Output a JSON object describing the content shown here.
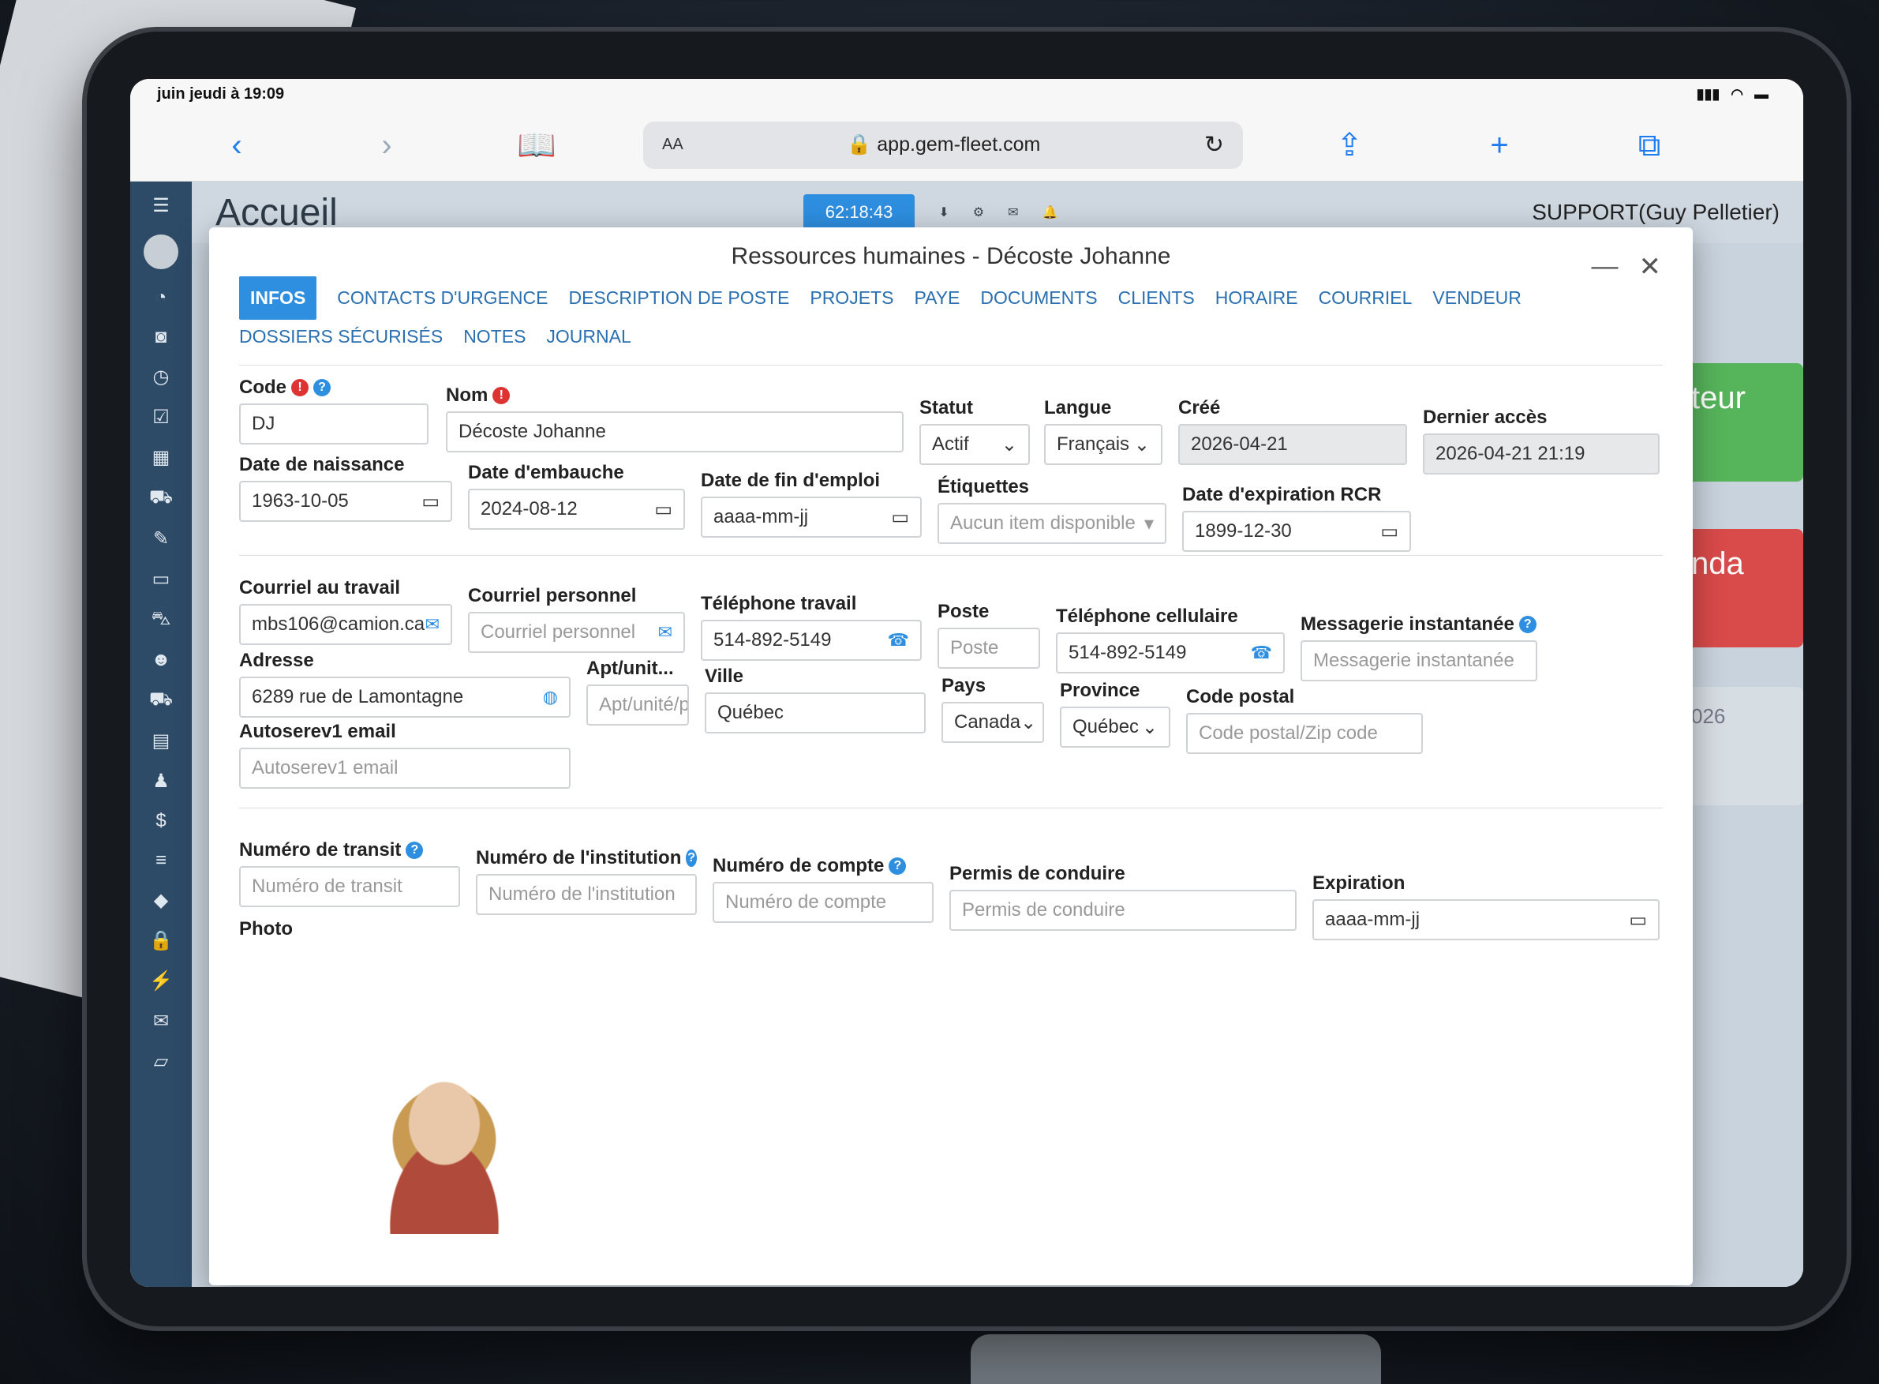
{
  "status": {
    "time": "juin jeudi à 19:09"
  },
  "browser": {
    "text_size": "AA",
    "url": "app.gem-fleet.com"
  },
  "app": {
    "title": "Accueil",
    "timer": "62:18:43",
    "user": "SUPPORT(Guy Pelletier)",
    "side_cards": [
      "teur",
      "nda",
      "026"
    ]
  },
  "modal": {
    "title": "Ressources humaines - Décoste Johanne",
    "tabs": [
      "INFOS",
      "CONTACTS D'URGENCE",
      "DESCRIPTION DE POSTE",
      "PROJETS",
      "PAYE",
      "DOCUMENTS",
      "CLIENTS",
      "HORAIRE",
      "COURRIEL",
      "VENDEUR"
    ],
    "tabs_row2": [
      "DOSSIERS SÉCURISÉS",
      "NOTES",
      "JOURNAL"
    ]
  },
  "form": {
    "code": {
      "label": "Code",
      "value": "DJ"
    },
    "nom": {
      "label": "Nom",
      "value": "Décoste Johanne"
    },
    "statut": {
      "label": "Statut",
      "value": "Actif"
    },
    "langue": {
      "label": "Langue",
      "value": "Français"
    },
    "cree": {
      "label": "Créé",
      "value": "2026-04-21"
    },
    "dernier_acces": {
      "label": "Dernier accès",
      "value": "2026-04-21 21:19"
    },
    "date_naissance": {
      "label": "Date de naissance",
      "value": "1963-10-05"
    },
    "date_embauche": {
      "label": "Date d'embauche",
      "value": "2024-08-12"
    },
    "date_fin": {
      "label": "Date de fin d'emploi",
      "placeholder": "aaaa-mm-jj"
    },
    "etiquettes": {
      "label": "Étiquettes",
      "placeholder": "Aucun item disponible"
    },
    "date_rcr": {
      "label": "Date d'expiration RCR",
      "value": "1899-12-30"
    },
    "courriel_travail": {
      "label": "Courriel au travail",
      "value": "mbs106@camion.ca"
    },
    "courriel_perso": {
      "label": "Courriel personnel",
      "placeholder": "Courriel personnel"
    },
    "tel_travail": {
      "label": "Téléphone travail",
      "value": "514-892-5149"
    },
    "poste": {
      "label": "Poste",
      "placeholder": "Poste"
    },
    "tel_cell": {
      "label": "Téléphone cellulaire",
      "value": "514-892-5149"
    },
    "messagerie": {
      "label": "Messagerie instantanée",
      "placeholder": "Messagerie instantanée"
    },
    "adresse": {
      "label": "Adresse",
      "value": "6289 rue de Lamontagne"
    },
    "apt": {
      "label": "Apt/unit...",
      "placeholder": "Apt/unité/porte"
    },
    "ville": {
      "label": "Ville",
      "value": "Québec"
    },
    "pays": {
      "label": "Pays",
      "value": "Canada"
    },
    "province": {
      "label": "Province",
      "value": "Québec"
    },
    "code_postal": {
      "label": "Code postal",
      "placeholder": "Code postal/Zip code"
    },
    "autoserev": {
      "label": "Autoserev1 email",
      "placeholder": "Autoserev1 email"
    },
    "transit": {
      "label": "Numéro de transit",
      "placeholder": "Numéro de transit"
    },
    "institution": {
      "label": "Numéro de l'institution",
      "placeholder": "Numéro de l'institution"
    },
    "compte": {
      "label": "Numéro de compte",
      "placeholder": "Numéro de compte"
    },
    "permis": {
      "label": "Permis de conduire",
      "placeholder": "Permis de conduire"
    },
    "expiration": {
      "label": "Expiration",
      "placeholder": "aaaa-mm-jj"
    },
    "photo": {
      "label": "Photo"
    }
  },
  "colors": {
    "accent": "#2e8ee0",
    "sidebar": "#2d4a66",
    "required": "#dd3333"
  }
}
